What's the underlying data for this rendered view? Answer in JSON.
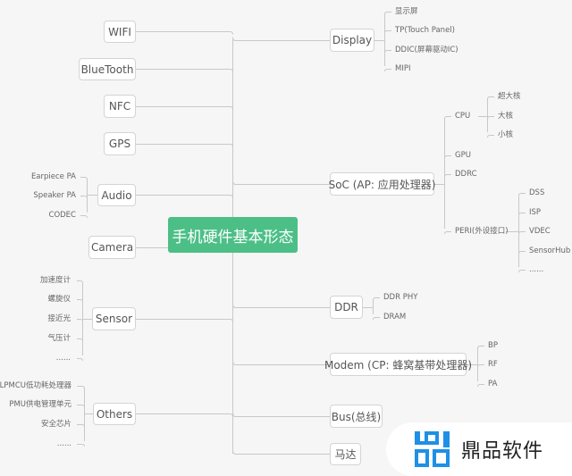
{
  "root": {
    "label": "手机硬件基本形态",
    "color": "#4cbf87"
  },
  "left_branches": [
    {
      "id": "wifi",
      "label": "WIFI",
      "children": []
    },
    {
      "id": "bluetooth",
      "label": "BlueTooth",
      "children": []
    },
    {
      "id": "nfc",
      "label": "NFC",
      "children": []
    },
    {
      "id": "gps",
      "label": "GPS",
      "children": []
    },
    {
      "id": "audio",
      "label": "Audio",
      "children": [
        "Earpiece PA",
        "Speaker PA",
        "CODEC"
      ]
    },
    {
      "id": "camera",
      "label": "Camera",
      "children": []
    },
    {
      "id": "sensor",
      "label": "Sensor",
      "children": [
        "加速度计",
        "螺旋仪",
        "接近光",
        "气压计",
        "......"
      ]
    },
    {
      "id": "others",
      "label": "Others",
      "children": [
        "LPMCU低功耗处理器",
        "PMU供电管理单元",
        "安全芯片",
        "......"
      ]
    }
  ],
  "right_branches": [
    {
      "id": "display",
      "label": "Display",
      "children": [
        "显示屏",
        "TP(Touch Panel)",
        "DDIC(屏幕驱动IC)",
        "MIPI"
      ]
    },
    {
      "id": "soc",
      "label": "SoC (AP: 应用处理器)",
      "children": [
        {
          "label": "CPU",
          "children": [
            "超大核",
            "大核",
            "小核"
          ]
        },
        {
          "label": "GPU",
          "children": []
        },
        {
          "label": "DDRC",
          "children": []
        },
        {
          "label": "PERI(外设接口)",
          "children": [
            "DSS",
            "ISP",
            "VDEC",
            "SensorHub",
            "......"
          ]
        }
      ]
    },
    {
      "id": "ddr",
      "label": "DDR",
      "children": [
        "DDR PHY",
        "DRAM"
      ]
    },
    {
      "id": "modem",
      "label": "Modem (CP: 蜂窝基带处理器)",
      "children": [
        "BP",
        "RF",
        "PA"
      ]
    },
    {
      "id": "bus",
      "label": "Bus(总线)",
      "children": []
    },
    {
      "id": "motor",
      "label": "马达",
      "children": []
    }
  ],
  "watermark": {
    "text": "鼎品软件",
    "color": "#1e90e6"
  }
}
